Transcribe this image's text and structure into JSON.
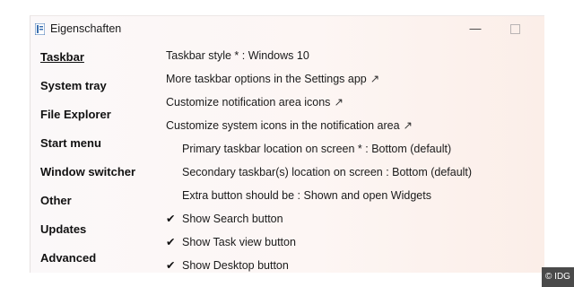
{
  "window": {
    "title": "Eigenschaften",
    "minimize_glyph": "—",
    "app_icon": "explorer-patcher-icon"
  },
  "sidebar": {
    "items": [
      {
        "label": "Taskbar",
        "active": true
      },
      {
        "label": "System tray"
      },
      {
        "label": "File Explorer"
      },
      {
        "label": "Start menu"
      },
      {
        "label": "Window switcher"
      },
      {
        "label": "Other"
      },
      {
        "label": "Updates"
      },
      {
        "label": "Advanced"
      }
    ]
  },
  "settings": {
    "taskbar_style": "Taskbar style * : Windows 10",
    "more_taskbar_options": "More taskbar options in the Settings app",
    "customize_notification_icons": "Customize notification area icons",
    "customize_system_icons": "Customize system icons in the notification area",
    "primary_location": "Primary taskbar location on screen * : Bottom (default)",
    "secondary_location": "Secondary taskbar(s) location on screen : Bottom (default)",
    "extra_button": "Extra button should be : Shown and open Widgets",
    "show_search": "Show Search button",
    "show_task_view": "Show Task view button",
    "show_desktop": "Show Desktop button",
    "external_link_glyph": "↗",
    "check_glyph": "✔"
  },
  "watermark": {
    "text": "© IDG"
  }
}
